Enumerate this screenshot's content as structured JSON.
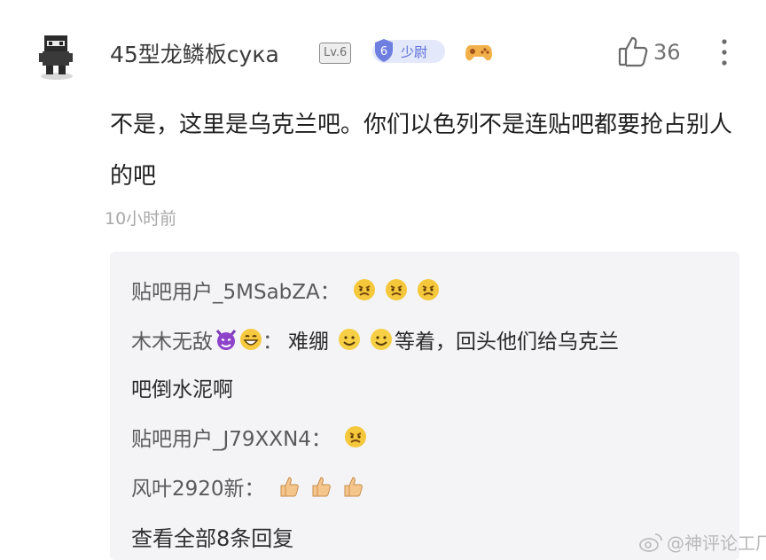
{
  "user": {
    "name": "45型龙鳞板сука",
    "level": "Lv.6",
    "rank_number": "6",
    "rank_title": "少尉"
  },
  "likes": {
    "count": "36"
  },
  "comment": {
    "text": "不是，这里是乌克兰吧。你们以色列不是连贴吧都要抢占别人的吧",
    "time": "10小时前"
  },
  "replies": [
    {
      "author": "贴吧用户_5MSabZA：",
      "emojis": [
        "angry-face",
        "angry-face",
        "angry-face"
      ],
      "text": ""
    },
    {
      "author": "木木无敌",
      "author_emojis": [
        "devil-face",
        "grin-face"
      ],
      "sep": "：",
      "text_a": "难绷",
      "emojis": [
        "smile-face",
        "smile-face"
      ],
      "text_b": "等着，回头他们给乌克兰",
      "text_c": "吧倒水泥啊"
    },
    {
      "author": "贴吧用户_J79XXN4：",
      "emojis": [
        "angry-face"
      ],
      "text": ""
    },
    {
      "author": "风叶2920新：",
      "emojis": [
        "thumbs-up",
        "thumbs-up",
        "thumbs-up"
      ],
      "text": ""
    }
  ],
  "view_all_label": "查看全部8条回复",
  "watermark": "@神评论工厂",
  "colors": {
    "rank_accent": "#5b6fd6",
    "reply_bg": "#f4f4f7",
    "muted": "#a8a8a8"
  }
}
